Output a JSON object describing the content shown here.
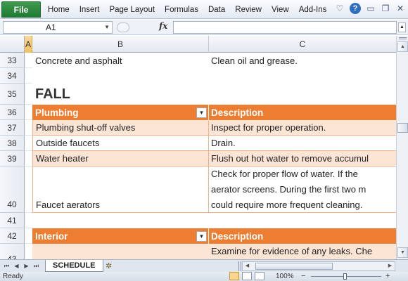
{
  "ribbon": {
    "file_label": "File",
    "tabs": [
      "Home",
      "Insert",
      "Page Layout",
      "Formulas",
      "Data",
      "Review",
      "View",
      "Add-Ins"
    ],
    "accent": "#1f7a33"
  },
  "formula_bar": {
    "name_box": "A1",
    "fx_label": "fx",
    "formula": ""
  },
  "columns": [
    "A",
    "B",
    "C"
  ],
  "rows": [
    {
      "num": "33",
      "b": "Concrete and asphalt",
      "c": "Clean oil and grease."
    },
    {
      "num": "34",
      "b": "",
      "c": ""
    },
    {
      "num": "35",
      "b": "FALL",
      "c": ""
    },
    {
      "num": "36",
      "b": "Plumbing",
      "c": "Description"
    },
    {
      "num": "37",
      "b": "Plumbing shut-off valves",
      "c": "Inspect for proper operation."
    },
    {
      "num": "38",
      "b": "Outside faucets",
      "c": "Drain."
    },
    {
      "num": "39",
      "b": "Water heater",
      "c": "Flush out hot water to remove accumul"
    },
    {
      "num": "40",
      "b": "Faucet aerators",
      "c_lines": [
        "Check for proper flow of water. If the",
        "aerator screens. During the first two m",
        "could require more frequent cleaning."
      ]
    },
    {
      "num": "41",
      "b": "",
      "c": ""
    },
    {
      "num": "42",
      "b": "Interior",
      "c": "Description"
    },
    {
      "num": "43",
      "b": "",
      "c": "Examine for evidence of any leaks. Che"
    }
  ],
  "sheet_tabs": {
    "active": "SCHEDULE"
  },
  "status_bar": {
    "ready": "Ready",
    "zoom": "100%",
    "zoom_minus": "−",
    "zoom_plus": "+"
  },
  "colors": {
    "header_orange": "#ed7d31",
    "light_orange": "#fde5d6"
  }
}
